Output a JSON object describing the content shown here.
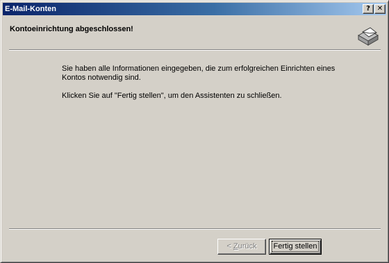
{
  "window": {
    "title": "E-Mail-Konten",
    "help_label": "?",
    "close_label": "✕"
  },
  "header": {
    "title": "Kontoeinrichtung abgeschlossen!",
    "icon": "mail-envelope-icon"
  },
  "content": {
    "paragraph1": "Sie haben alle Informationen eingegeben, die zum erfolgreichen Einrichten eines Kontos notwendig sind.",
    "paragraph2": "Klicken Sie auf \"Fertig stellen\", um den Assistenten zu schließen."
  },
  "buttons": {
    "back_prefix": "< ",
    "back_accel": "Z",
    "back_rest": "urück",
    "back_enabled": false,
    "finish_label": "Fertig stellen",
    "finish_default": true
  },
  "colors": {
    "titlebar_start": "#0a246a",
    "titlebar_end": "#a6caf0",
    "face": "#d4d0c8"
  }
}
